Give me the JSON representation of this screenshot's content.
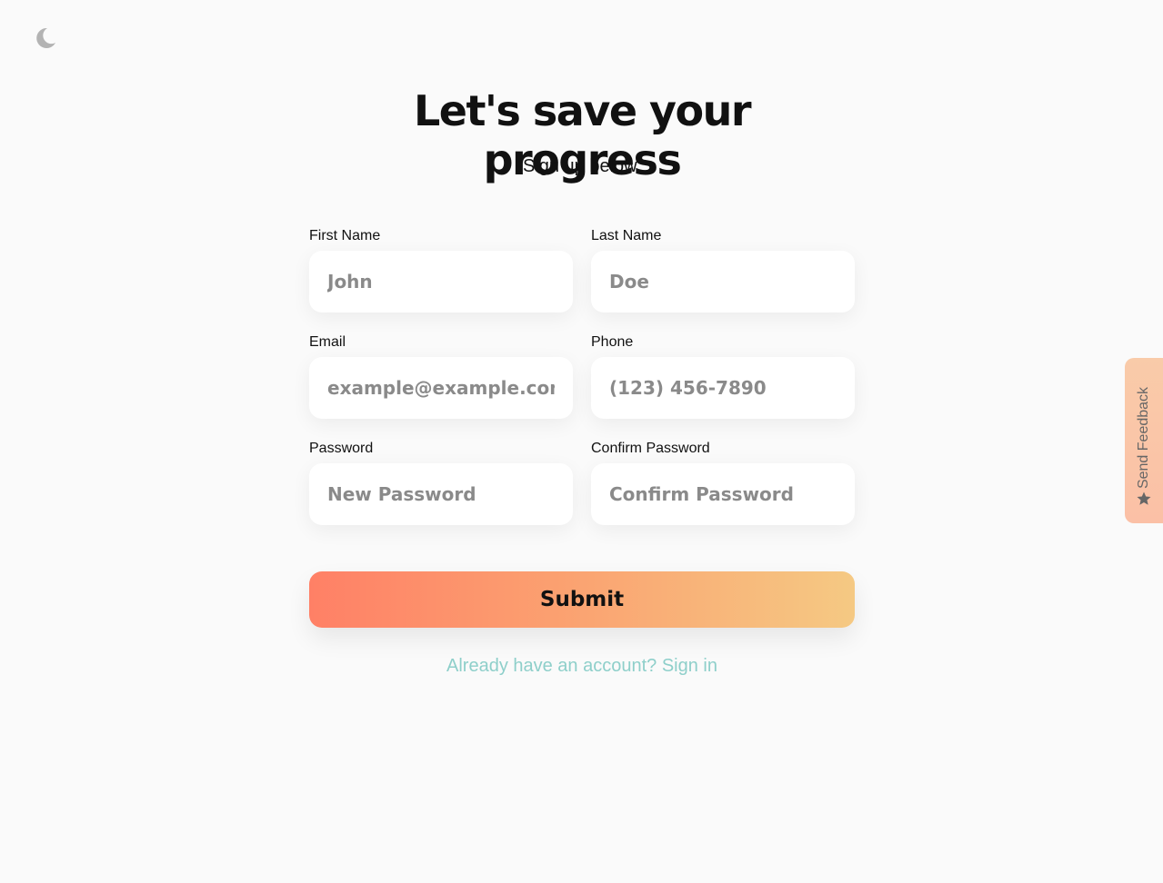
{
  "header": {
    "theme_toggle_icon": "moon-icon"
  },
  "heading": {
    "title": "Let's save your progress",
    "subtitle": "Sign up below."
  },
  "form": {
    "first_name": {
      "label": "First Name",
      "placeholder": "John",
      "value": ""
    },
    "last_name": {
      "label": "Last Name",
      "placeholder": "Doe",
      "value": ""
    },
    "email": {
      "label": "Email",
      "placeholder": "example@example.com",
      "value": ""
    },
    "phone": {
      "label": "Phone",
      "placeholder": "(123) 456-7890",
      "value": ""
    },
    "password": {
      "label": "Password",
      "placeholder": "New Password",
      "value": ""
    },
    "confirm_password": {
      "label": "Confirm Password",
      "placeholder": "Confirm Password",
      "value": ""
    },
    "submit_label": "Submit"
  },
  "footer": {
    "signin_link": "Already have an account? Sign in"
  },
  "feedback": {
    "label": "Send Feedback",
    "icon": "star-icon"
  },
  "colors": {
    "background": "#fafafa",
    "submit_gradient_start": "#ff8066",
    "submit_gradient_end": "#f5c983",
    "link": "#8ecfca",
    "feedback_tab": "#f9cba9"
  }
}
